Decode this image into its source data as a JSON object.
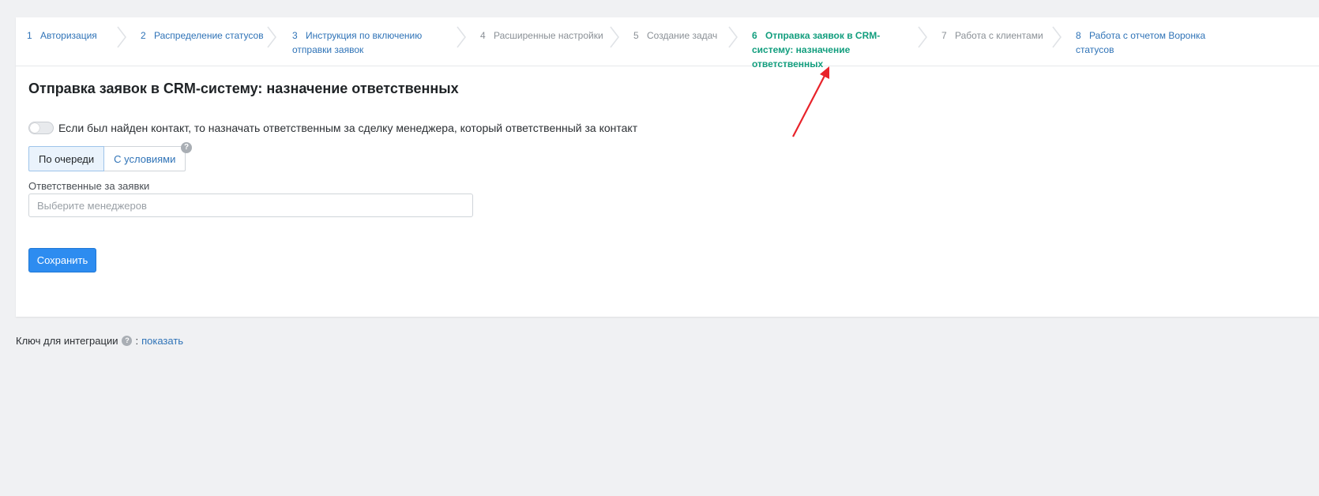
{
  "steps": [
    {
      "num": "1",
      "label": "Авторизация",
      "state": "link"
    },
    {
      "num": "2",
      "label": "Распределение статусов",
      "state": "link"
    },
    {
      "num": "3",
      "label": "Инструкция по включению отправки заявок",
      "state": "link"
    },
    {
      "num": "4",
      "label": "Расширенные настройки",
      "state": "gray"
    },
    {
      "num": "5",
      "label": "Создание задач",
      "state": "gray"
    },
    {
      "num": "6",
      "label": "Отправка заявок в CRM-систему: назначение ответственных",
      "state": "active"
    },
    {
      "num": "7",
      "label": "Работа с клиентами",
      "state": "gray"
    },
    {
      "num": "8",
      "label": "Работа с отчетом Воронка статусов",
      "state": "link"
    }
  ],
  "page": {
    "title": "Отправка заявок в CRM-систему: назначение ответственных",
    "toggle_label": "Если был найден контакт, то назначать ответственным за сделку менеджера, который ответственный за контакт",
    "mode_options": [
      "По очереди",
      "С условиями"
    ],
    "help_glyph": "?",
    "responsible_label": "Ответственные за заявки",
    "responsible_placeholder": "Выберите менеджеров",
    "save_label": "Сохранить"
  },
  "footer": {
    "key_label": "Ключ для интеграции",
    "separator": ":",
    "show_link": "показать"
  },
  "colors": {
    "link": "#2f73b7",
    "active_step": "#129e7e",
    "primary_button": "#2d8cf0",
    "annotation_arrow": "#e8232a"
  }
}
